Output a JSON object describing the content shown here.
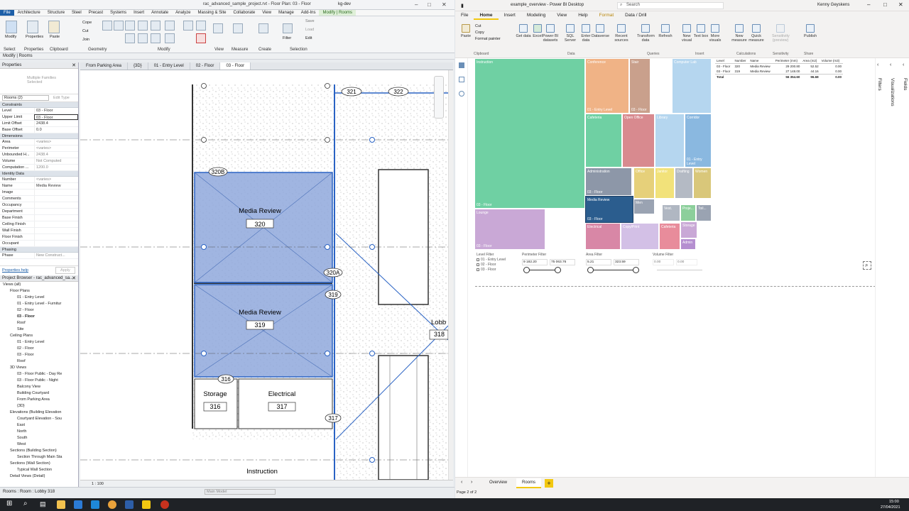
{
  "revit": {
    "title": "rac_advanced_sample_project.rvt - Floor Plan: 03 - Floor",
    "user": "kg-dev",
    "menu": [
      "File",
      "Architecture",
      "Structure",
      "Steel",
      "Precast",
      "Systems",
      "Insert",
      "Annotate",
      "Analyze",
      "Massing & Site",
      "Collaborate",
      "View",
      "Manage",
      "Add-Ins",
      "Modify | Rooms"
    ],
    "ribbon_groups": [
      "Select",
      "Properties",
      "Clipboard",
      "Geometry",
      "Modify",
      "View",
      "Measure",
      "Create",
      "Selection"
    ],
    "ribbon_labels": {
      "modify": "Modify",
      "properties": "Properties",
      "paste": "Paste",
      "cope": "Cope",
      "cut": "Cut",
      "join": "Join",
      "filter": "Filter",
      "save": "Save",
      "load": "Load",
      "edit": "Edit"
    },
    "modify_bar": "Modify | Rooms",
    "properties": {
      "header": "Properties",
      "type_label": "Multiple Families Selected",
      "selector": "Rooms (2)",
      "edit_type": "Edit Type",
      "sections": [
        {
          "name": "Constraints",
          "rows": [
            [
              "Level",
              "03 - Floor"
            ],
            [
              "Upper Limit",
              "03 - Floor"
            ],
            [
              "Limit Offset",
              "2438.4"
            ],
            [
              "Base Offset",
              "0.0"
            ]
          ]
        },
        {
          "name": "Dimensions",
          "rows": [
            [
              "Area",
              "<varies>"
            ],
            [
              "Perimeter",
              "<varies>"
            ],
            [
              "Unbounded H...",
              "2438.4"
            ],
            [
              "Volume",
              "Not Computed"
            ],
            [
              "Computation ...",
              "1200.0"
            ]
          ]
        },
        {
          "name": "Identity Data",
          "rows": [
            [
              "Number",
              "<varies>"
            ],
            [
              "Name",
              "Media Review"
            ],
            [
              "Image",
              ""
            ],
            [
              "Comments",
              ""
            ],
            [
              "Occupancy",
              ""
            ],
            [
              "Department",
              ""
            ],
            [
              "Base Finish",
              ""
            ],
            [
              "Ceiling Finish",
              ""
            ],
            [
              "Wall Finish",
              ""
            ],
            [
              "Floor Finish",
              ""
            ],
            [
              "Occupant",
              ""
            ]
          ]
        },
        {
          "name": "Phasing",
          "rows": [
            [
              "Phase",
              "New Construct..."
            ]
          ]
        }
      ],
      "help": "Properties help",
      "apply": "Apply"
    },
    "browser": {
      "header": "Project Browser - rac_advanced_sa...",
      "items": [
        "Views (all)",
        "Floor Plans",
        "01 - Entry Level",
        "01 - Entry Level - Furnitur",
        "02 - Floor",
        "03 - Floor",
        "Roof",
        "Site",
        "Ceiling Plans",
        "01 - Entry Level",
        "02 - Floor",
        "03 - Floor",
        "Roof",
        "3D Views",
        "03 - Floor Public - Day Re",
        "03 - Floor Public - Night",
        "Balcony View",
        "Building Courtyard",
        "From Parking Area",
        "{3D}",
        "Elevations (Building Elevation",
        "Courtyard Elevation - Sou",
        "East",
        "North",
        "South",
        "West",
        "Sections (Building Section)",
        "Section Through Main Sta",
        "Sections (Wall Section)",
        "Typical Wall Section",
        "Detail Views (Detail)"
      ]
    },
    "view_tabs": [
      "From Parking Area",
      "{3D}",
      "01 - Entry Level",
      "02 - Floor",
      "03 - Floor"
    ],
    "rooms": [
      {
        "name": "Media Review",
        "number": "320"
      },
      {
        "name": "Media Review",
        "number": "319"
      },
      {
        "name": "Storage",
        "number": "316"
      },
      {
        "name": "Electrical",
        "number": "317"
      },
      {
        "name": "Instruction",
        "number": ""
      },
      {
        "name": "Lobb",
        "number": "318"
      }
    ],
    "tags": [
      "321",
      "322",
      "320B",
      "320A",
      "319",
      "316",
      "317"
    ],
    "scale": "1 : 100",
    "status": "Rooms : Room : Lobby 318",
    "model": "Main Model"
  },
  "pbi": {
    "title": "example_overview - Power BI Desktop",
    "search": "Search",
    "user": "Kenny Geyskens",
    "tabs": [
      "File",
      "Home",
      "Insert",
      "Modeling",
      "View",
      "Help",
      "Format",
      "Data / Drill"
    ],
    "ribbon": {
      "paste": "Paste",
      "cut": "Cut",
      "copy": "Copy",
      "format_painter": "Format painter",
      "buttons": [
        "Get data",
        "Excel",
        "Power BI datasets",
        "SQL Server",
        "Enter data",
        "Dataverse",
        "Recent sources",
        "Transform data",
        "Refresh",
        "New visual",
        "Text box",
        "More visuals",
        "New measure",
        "Quick measure",
        "Sensitivity (preview)",
        "Publish"
      ],
      "groups": [
        "Clipboard",
        "Data",
        "Queries",
        "Insert",
        "Calculations",
        "Sensitivity",
        "Share"
      ]
    },
    "treemap": [
      {
        "label": "Instruction",
        "footer": "03 - Floor",
        "color": "#6fd0a3"
      },
      {
        "label": "Conference",
        "footer": "01 - Entry Level",
        "color": "#f0b386"
      },
      {
        "label": "Stair",
        "footer": "03 - Floor",
        "color": "#c9a08c"
      },
      {
        "label": "Computer Lab",
        "footer": "",
        "color": "#b5d6ef"
      },
      {
        "label": "Cafeteria",
        "footer": "",
        "color": "#6fd0a3"
      },
      {
        "label": "Open Office",
        "footer": "",
        "color": "#d88a8f"
      },
      {
        "label": "Library",
        "footer": "",
        "color": "#b5d6ef"
      },
      {
        "label": "Corridor",
        "footer": "01 - Entry Level",
        "color": "#8ab8e0"
      },
      {
        "label": "Administration",
        "footer": "03 - Floor",
        "color": "#8d97a8"
      },
      {
        "label": "Office",
        "footer": "",
        "color": "#e6d07a"
      },
      {
        "label": "Janitor",
        "footer": "",
        "color": "#f2e27a"
      },
      {
        "label": "Drafting",
        "footer": "",
        "color": "#b4bac4"
      },
      {
        "label": "Women",
        "footer": "",
        "color": "#d9c77a"
      },
      {
        "label": "Media Review",
        "footer": "03 - Floor",
        "color": "#2b5d8e"
      },
      {
        "label": "Men",
        "footer": "",
        "color": "#9aa3b2"
      },
      {
        "label": "Vest.",
        "footer": "",
        "color": "#b0b7c2"
      },
      {
        "label": "Proje...",
        "footer": "",
        "color": "#8ccf9b"
      },
      {
        "label": "Toil...",
        "footer": "",
        "color": "#9aa3b2"
      },
      {
        "label": "Lounge",
        "footer": "03 - Floor",
        "color": "#c9a8d6"
      },
      {
        "label": "Electrical",
        "footer": "",
        "color": "#d887a6"
      },
      {
        "label": "Copy/Print",
        "footer": "",
        "color": "#d3c0e6"
      },
      {
        "label": "Cafeteria",
        "footer": "",
        "color": "#e88c9b"
      },
      {
        "label": "Storage",
        "footer": "",
        "color": "#c9a8d6"
      },
      {
        "label": "Admin",
        "footer": "",
        "color": "#b58fd0"
      }
    ],
    "table": {
      "headers": [
        "Level",
        "Number",
        "Name",
        "Perimeter (mm)",
        "Area (m2)",
        "Volume (m3)"
      ],
      "rows": [
        [
          "03 - Floor",
          "320",
          "Media Review",
          "29 200.80",
          "52.52",
          "0.00"
        ],
        [
          "03 - Floor",
          "319",
          "Media Review",
          "27 148.00",
          "44.16",
          "0.00"
        ]
      ],
      "total": [
        "Total",
        "",
        "",
        "56 354.60",
        "96.68",
        "0.00"
      ]
    },
    "filters": {
      "level": {
        "title": "Level Filter",
        "options": [
          "01 - Entry Level",
          "02 - Floor",
          "03 - Floor"
        ]
      },
      "perimeter": {
        "title": "Perimeter Filter",
        "min": "9 182.20",
        "max": "75 063.76"
      },
      "area": {
        "title": "Area Filter",
        "min": "5.21",
        "max": "323.59"
      },
      "volume": {
        "title": "Volume Filter",
        "min": "0.00",
        "max": "0.00"
      }
    },
    "right_panes": [
      "Filters",
      "Visualizations",
      "Fields"
    ],
    "pages": [
      "Overview",
      "Rooms"
    ],
    "page_status": "Page 2 of 2"
  },
  "clock": {
    "time": "15:00",
    "date": "27/04/2021"
  }
}
